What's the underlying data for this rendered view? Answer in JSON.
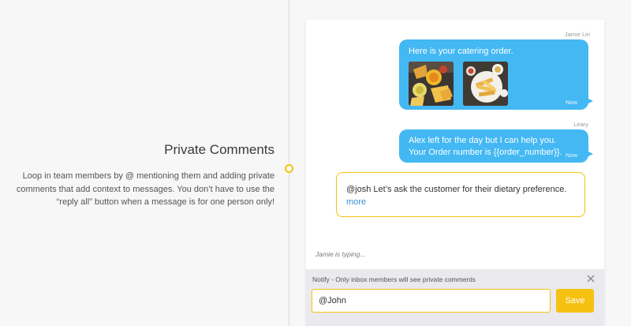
{
  "feature": {
    "title": "Private Comments",
    "description": "Loop in team members by @ mentioning them and adding private comments that add context to messages. You don’t have to use the “reply all” button when a message is for one person only!"
  },
  "chat": {
    "messages": [
      {
        "sender": "Jamie Lin",
        "text": "Here is your catering order.",
        "time": "Now",
        "attachments": [
          "nachos-photo",
          "fries-photo"
        ]
      },
      {
        "sender": "Leary",
        "text_line1": "Alex left for the day but I can help you.",
        "text_line2": "Your Order number is {{order_number}}.",
        "time": "Now"
      }
    ],
    "private_comment": {
      "text": "@josh Let’s ask the customer for their dietary preference.",
      "more_label": "more"
    },
    "typing_status": "Jamie is typing...",
    "notify_text": "Notify - Only inbox members will see private comments",
    "input_value": "@John",
    "save_label": "Save"
  },
  "colors": {
    "bubble": "#43b8f3",
    "accent": "#f4c20d",
    "save_button": "#f7c111",
    "link": "#3a8fd6"
  }
}
